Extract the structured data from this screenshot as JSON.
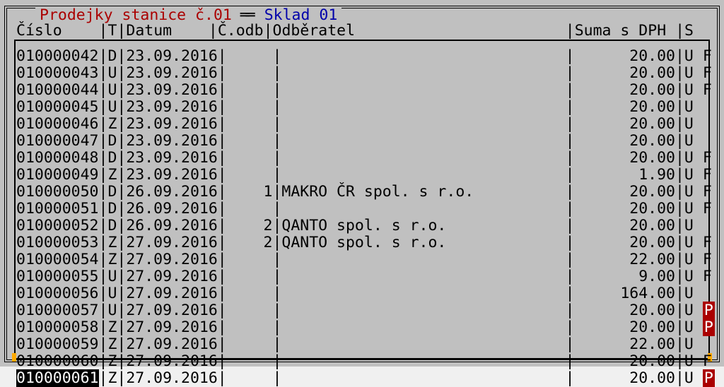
{
  "title": {
    "part1": "Prodejky stanice č.01",
    "part2": "Sklad 01"
  },
  "columns": {
    "cislo": "Číslo",
    "t": "T",
    "datum": "Datum",
    "codb": "Č.odb",
    "odberatel": "Odběratel",
    "suma": "Suma s DPH",
    "s": "S"
  },
  "rows": [
    {
      "cislo": "010000042",
      "t": "D",
      "datum": "23.09.2016",
      "codb": "",
      "odberatel": "",
      "suma": "20.00",
      "s": "U",
      "flag": "F"
    },
    {
      "cislo": "010000043",
      "t": "U",
      "datum": "23.09.2016",
      "codb": "",
      "odberatel": "",
      "suma": "20.00",
      "s": "U",
      "flag": "F"
    },
    {
      "cislo": "010000044",
      "t": "U",
      "datum": "23.09.2016",
      "codb": "",
      "odberatel": "",
      "suma": "20.00",
      "s": "U",
      "flag": "F"
    },
    {
      "cislo": "010000045",
      "t": "U",
      "datum": "23.09.2016",
      "codb": "",
      "odberatel": "",
      "suma": "20.00",
      "s": "U",
      "flag": ""
    },
    {
      "cislo": "010000046",
      "t": "Z",
      "datum": "23.09.2016",
      "codb": "",
      "odberatel": "",
      "suma": "20.00",
      "s": "U",
      "flag": ""
    },
    {
      "cislo": "010000047",
      "t": "D",
      "datum": "23.09.2016",
      "codb": "",
      "odberatel": "",
      "suma": "20.00",
      "s": "U",
      "flag": ""
    },
    {
      "cislo": "010000048",
      "t": "D",
      "datum": "23.09.2016",
      "codb": "",
      "odberatel": "",
      "suma": "20.00",
      "s": "U",
      "flag": "F"
    },
    {
      "cislo": "010000049",
      "t": "Z",
      "datum": "23.09.2016",
      "codb": "",
      "odberatel": "",
      "suma": "1.90",
      "s": "U",
      "flag": "F"
    },
    {
      "cislo": "010000050",
      "t": "D",
      "datum": "26.09.2016",
      "codb": "1",
      "odberatel": "MAKRO ČR spol. s r.o.",
      "suma": "20.00",
      "s": "U",
      "flag": "F"
    },
    {
      "cislo": "010000051",
      "t": "D",
      "datum": "26.09.2016",
      "codb": "",
      "odberatel": "",
      "suma": "20.00",
      "s": "U",
      "flag": "F"
    },
    {
      "cislo": "010000052",
      "t": "D",
      "datum": "26.09.2016",
      "codb": "2",
      "odberatel": "QANTO spol. s r.o.",
      "suma": "20.00",
      "s": "U",
      "flag": ""
    },
    {
      "cislo": "010000053",
      "t": "Z",
      "datum": "27.09.2016",
      "codb": "2",
      "odberatel": "QANTO spol. s r.o.",
      "suma": "20.00",
      "s": "U",
      "flag": "F"
    },
    {
      "cislo": "010000054",
      "t": "Z",
      "datum": "27.09.2016",
      "codb": "",
      "odberatel": "",
      "suma": "22.00",
      "s": "U",
      "flag": "F"
    },
    {
      "cislo": "010000055",
      "t": "U",
      "datum": "27.09.2016",
      "codb": "",
      "odberatel": "",
      "suma": "9.00",
      "s": "U",
      "flag": "F"
    },
    {
      "cislo": "010000056",
      "t": "U",
      "datum": "27.09.2016",
      "codb": "",
      "odberatel": "",
      "suma": "164.00",
      "s": "U",
      "flag": ""
    },
    {
      "cislo": "010000057",
      "t": "U",
      "datum": "27.09.2016",
      "codb": "",
      "odberatel": "",
      "suma": "20.00",
      "s": "U",
      "flag": "P"
    },
    {
      "cislo": "010000058",
      "t": "Z",
      "datum": "27.09.2016",
      "codb": "",
      "odberatel": "",
      "suma": "20.00",
      "s": "U",
      "flag": "P"
    },
    {
      "cislo": "010000059",
      "t": "Z",
      "datum": "27.09.2016",
      "codb": "",
      "odberatel": "",
      "suma": "22.00",
      "s": "U",
      "flag": ""
    },
    {
      "cislo": "010000060",
      "t": "Z",
      "datum": "27.09.2016",
      "codb": "",
      "odberatel": "",
      "suma": "20.00",
      "s": "U",
      "flag": "F"
    },
    {
      "cislo": "010000061",
      "t": "Z",
      "datum": "27.09.2016",
      "codb": "",
      "odberatel": "",
      "suma": "20.00",
      "s": "U",
      "flag": "P",
      "selected": true
    }
  ]
}
